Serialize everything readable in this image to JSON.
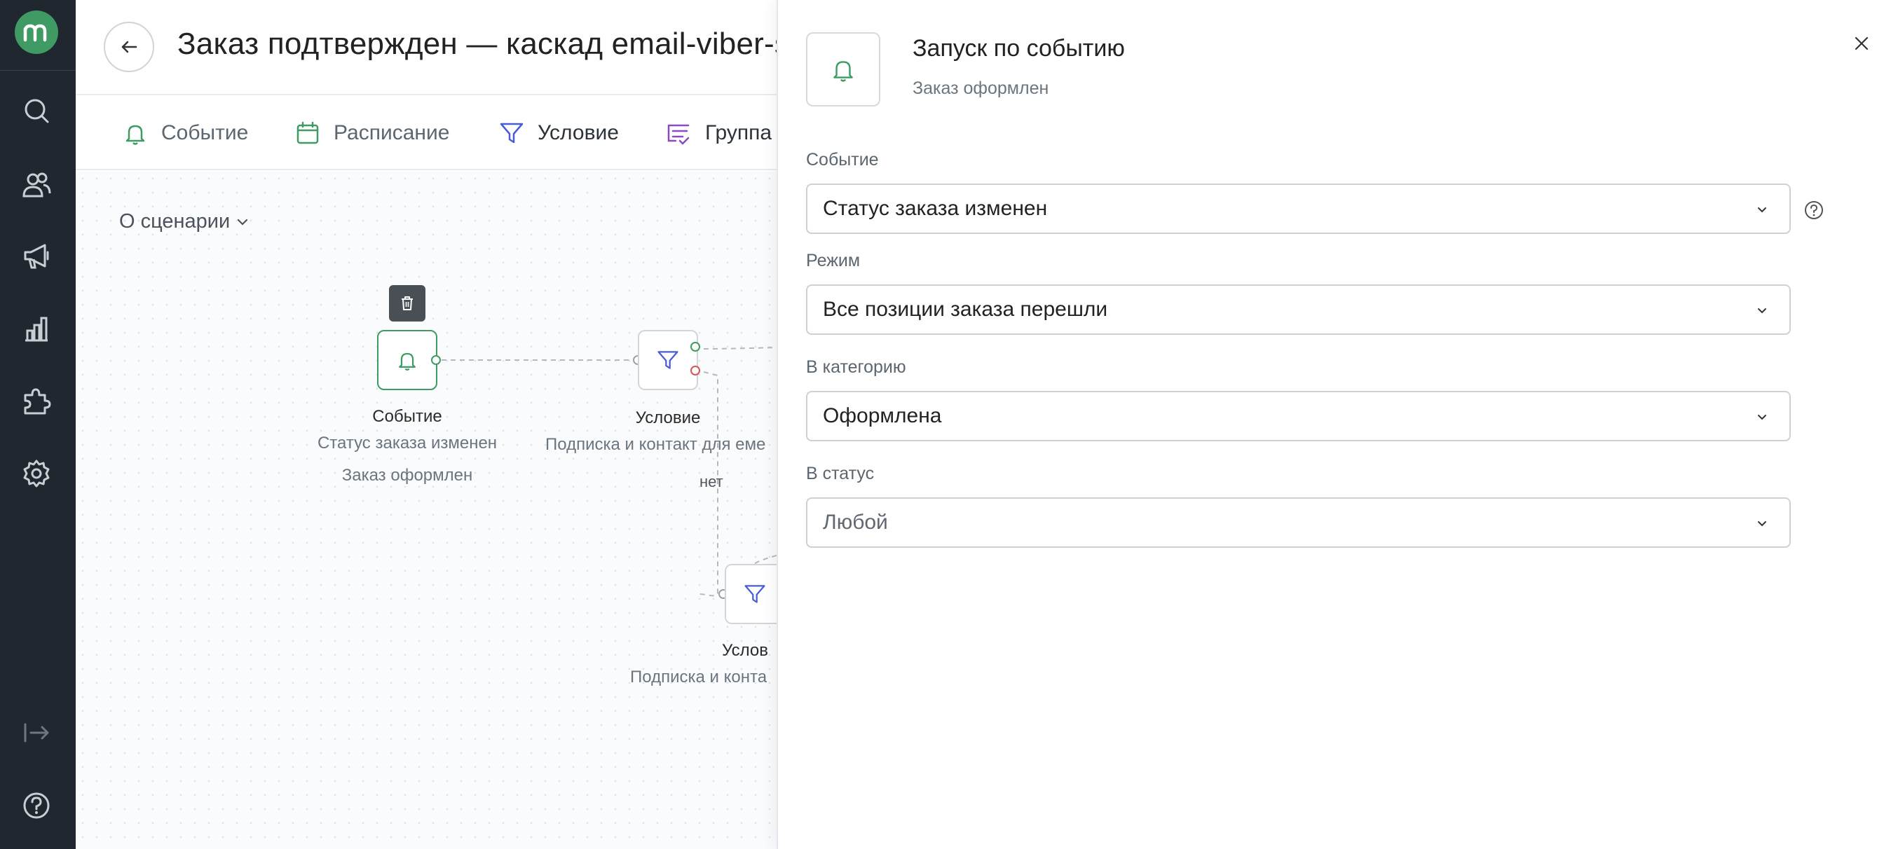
{
  "header": {
    "title": "Заказ подтвержден — каскад email-viber-s"
  },
  "toolbar": {
    "items": [
      {
        "label": "Событие",
        "icon": "bell-icon"
      },
      {
        "label": "Расписание",
        "icon": "calendar-icon"
      },
      {
        "label": "Условие",
        "icon": "filter-icon"
      },
      {
        "label": "Группа",
        "icon": "group-icon"
      }
    ]
  },
  "canvas": {
    "about_label": "О сценарии",
    "nodes": {
      "event": {
        "label": "Событие",
        "sub1": "Статус заказа изменен",
        "sub2": "Заказ оформлен"
      },
      "condition1": {
        "label": "Условие",
        "sub1": "Подписка и контакт для еме"
      },
      "condition2": {
        "label": "Услов",
        "sub1": "Подписка и конта"
      }
    },
    "edge_no_label": "нет"
  },
  "drawer": {
    "title": "Запуск по событию",
    "subtitle": "Заказ оформлен",
    "fields": [
      {
        "label": "Событие",
        "value": "Статус заказа изменен"
      },
      {
        "label": "Режим",
        "value": "Все позиции заказа перешли"
      },
      {
        "label": "В категорию",
        "value": "Оформлена"
      },
      {
        "label": "В статус",
        "value": "Любой"
      }
    ]
  },
  "colors": {
    "accent_green": "#3f9a63",
    "rail_bg": "#20272f",
    "filter_blue": "#4a5bd6",
    "group_purple": "#8a4bc0",
    "port_red": "#d9534f"
  }
}
